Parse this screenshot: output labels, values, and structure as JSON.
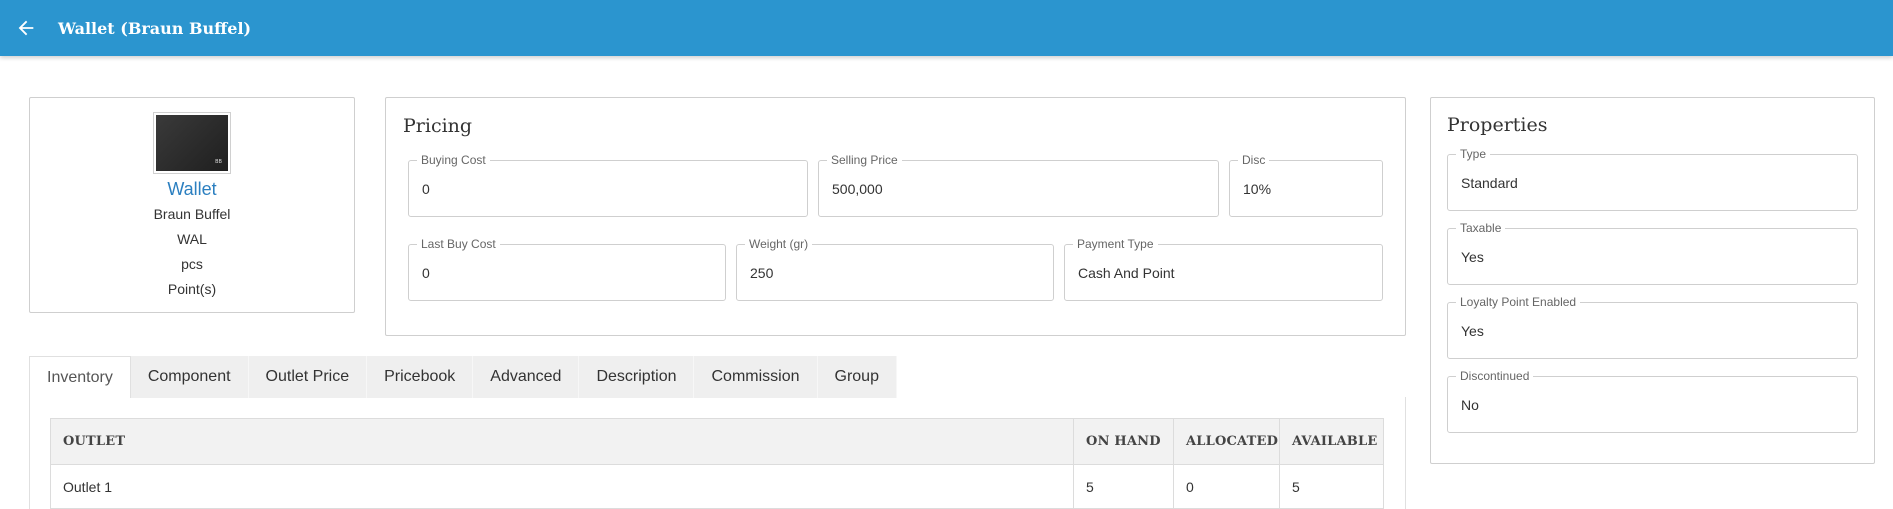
{
  "header": {
    "title": "Wallet (Braun Buffel)"
  },
  "product": {
    "name": "Wallet",
    "brand": "Braun Buffel",
    "code": "WAL",
    "unit": "pcs",
    "points": "Point(s)"
  },
  "pricing": {
    "title": "Pricing",
    "buying_cost": {
      "label": "Buying Cost",
      "value": "0"
    },
    "selling_price": {
      "label": "Selling Price",
      "value": "500,000"
    },
    "disc": {
      "label": "Disc",
      "value": "10%"
    },
    "last_buy_cost": {
      "label": "Last Buy Cost",
      "value": "0"
    },
    "weight": {
      "label": "Weight (gr)",
      "value": "250"
    },
    "payment_type": {
      "label": "Payment Type",
      "value": "Cash And Point"
    }
  },
  "properties": {
    "title": "Properties",
    "type": {
      "label": "Type",
      "value": "Standard"
    },
    "taxable": {
      "label": "Taxable",
      "value": "Yes"
    },
    "loyalty": {
      "label": "Loyalty Point Enabled",
      "value": "Yes"
    },
    "discontinued": {
      "label": "Discontinued",
      "value": "No"
    }
  },
  "tabs": [
    "Inventory",
    "Component",
    "Outlet Price",
    "Pricebook",
    "Advanced",
    "Description",
    "Commission",
    "Group"
  ],
  "inventory": {
    "columns": [
      "OUTLET",
      "ON HAND",
      "ALLOCATED",
      "AVAILABLE"
    ],
    "rows": [
      {
        "outlet": "Outlet 1",
        "on_hand": "5",
        "allocated": "0",
        "available": "5"
      }
    ]
  }
}
